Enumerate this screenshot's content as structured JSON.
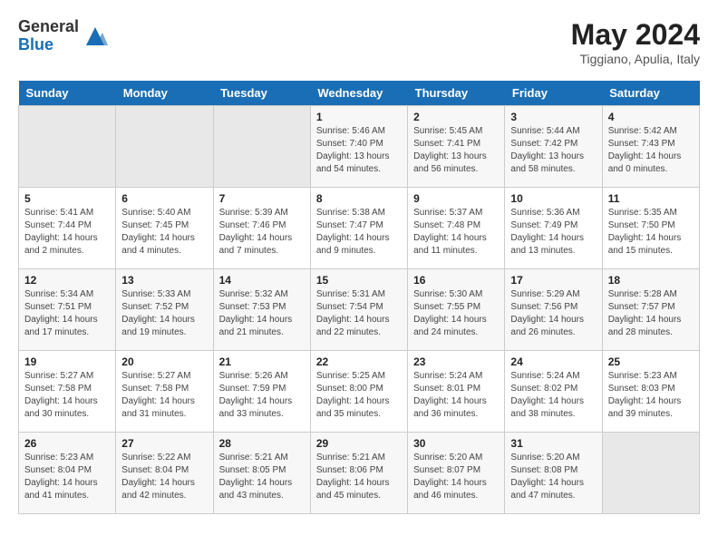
{
  "header": {
    "logo_general": "General",
    "logo_blue": "Blue",
    "title": "May 2024",
    "location": "Tiggiano, Apulia, Italy"
  },
  "days_of_week": [
    "Sunday",
    "Monday",
    "Tuesday",
    "Wednesday",
    "Thursday",
    "Friday",
    "Saturday"
  ],
  "weeks": [
    {
      "days": [
        {
          "number": "",
          "info": "",
          "empty": true
        },
        {
          "number": "",
          "info": "",
          "empty": true
        },
        {
          "number": "",
          "info": "",
          "empty": true
        },
        {
          "number": "1",
          "info": "Sunrise: 5:46 AM\nSunset: 7:40 PM\nDaylight: 13 hours and 54 minutes."
        },
        {
          "number": "2",
          "info": "Sunrise: 5:45 AM\nSunset: 7:41 PM\nDaylight: 13 hours and 56 minutes."
        },
        {
          "number": "3",
          "info": "Sunrise: 5:44 AM\nSunset: 7:42 PM\nDaylight: 13 hours and 58 minutes."
        },
        {
          "number": "4",
          "info": "Sunrise: 5:42 AM\nSunset: 7:43 PM\nDaylight: 14 hours and 0 minutes."
        }
      ]
    },
    {
      "days": [
        {
          "number": "5",
          "info": "Sunrise: 5:41 AM\nSunset: 7:44 PM\nDaylight: 14 hours and 2 minutes."
        },
        {
          "number": "6",
          "info": "Sunrise: 5:40 AM\nSunset: 7:45 PM\nDaylight: 14 hours and 4 minutes."
        },
        {
          "number": "7",
          "info": "Sunrise: 5:39 AM\nSunset: 7:46 PM\nDaylight: 14 hours and 7 minutes."
        },
        {
          "number": "8",
          "info": "Sunrise: 5:38 AM\nSunset: 7:47 PM\nDaylight: 14 hours and 9 minutes."
        },
        {
          "number": "9",
          "info": "Sunrise: 5:37 AM\nSunset: 7:48 PM\nDaylight: 14 hours and 11 minutes."
        },
        {
          "number": "10",
          "info": "Sunrise: 5:36 AM\nSunset: 7:49 PM\nDaylight: 14 hours and 13 minutes."
        },
        {
          "number": "11",
          "info": "Sunrise: 5:35 AM\nSunset: 7:50 PM\nDaylight: 14 hours and 15 minutes."
        }
      ]
    },
    {
      "days": [
        {
          "number": "12",
          "info": "Sunrise: 5:34 AM\nSunset: 7:51 PM\nDaylight: 14 hours and 17 minutes."
        },
        {
          "number": "13",
          "info": "Sunrise: 5:33 AM\nSunset: 7:52 PM\nDaylight: 14 hours and 19 minutes."
        },
        {
          "number": "14",
          "info": "Sunrise: 5:32 AM\nSunset: 7:53 PM\nDaylight: 14 hours and 21 minutes."
        },
        {
          "number": "15",
          "info": "Sunrise: 5:31 AM\nSunset: 7:54 PM\nDaylight: 14 hours and 22 minutes."
        },
        {
          "number": "16",
          "info": "Sunrise: 5:30 AM\nSunset: 7:55 PM\nDaylight: 14 hours and 24 minutes."
        },
        {
          "number": "17",
          "info": "Sunrise: 5:29 AM\nSunset: 7:56 PM\nDaylight: 14 hours and 26 minutes."
        },
        {
          "number": "18",
          "info": "Sunrise: 5:28 AM\nSunset: 7:57 PM\nDaylight: 14 hours and 28 minutes."
        }
      ]
    },
    {
      "days": [
        {
          "number": "19",
          "info": "Sunrise: 5:27 AM\nSunset: 7:58 PM\nDaylight: 14 hours and 30 minutes."
        },
        {
          "number": "20",
          "info": "Sunrise: 5:27 AM\nSunset: 7:58 PM\nDaylight: 14 hours and 31 minutes."
        },
        {
          "number": "21",
          "info": "Sunrise: 5:26 AM\nSunset: 7:59 PM\nDaylight: 14 hours and 33 minutes."
        },
        {
          "number": "22",
          "info": "Sunrise: 5:25 AM\nSunset: 8:00 PM\nDaylight: 14 hours and 35 minutes."
        },
        {
          "number": "23",
          "info": "Sunrise: 5:24 AM\nSunset: 8:01 PM\nDaylight: 14 hours and 36 minutes."
        },
        {
          "number": "24",
          "info": "Sunrise: 5:24 AM\nSunset: 8:02 PM\nDaylight: 14 hours and 38 minutes."
        },
        {
          "number": "25",
          "info": "Sunrise: 5:23 AM\nSunset: 8:03 PM\nDaylight: 14 hours and 39 minutes."
        }
      ]
    },
    {
      "days": [
        {
          "number": "26",
          "info": "Sunrise: 5:23 AM\nSunset: 8:04 PM\nDaylight: 14 hours and 41 minutes."
        },
        {
          "number": "27",
          "info": "Sunrise: 5:22 AM\nSunset: 8:04 PM\nDaylight: 14 hours and 42 minutes."
        },
        {
          "number": "28",
          "info": "Sunrise: 5:21 AM\nSunset: 8:05 PM\nDaylight: 14 hours and 43 minutes."
        },
        {
          "number": "29",
          "info": "Sunrise: 5:21 AM\nSunset: 8:06 PM\nDaylight: 14 hours and 45 minutes."
        },
        {
          "number": "30",
          "info": "Sunrise: 5:20 AM\nSunset: 8:07 PM\nDaylight: 14 hours and 46 minutes."
        },
        {
          "number": "31",
          "info": "Sunrise: 5:20 AM\nSunset: 8:08 PM\nDaylight: 14 hours and 47 minutes."
        },
        {
          "number": "",
          "info": "",
          "empty": true
        }
      ]
    }
  ]
}
